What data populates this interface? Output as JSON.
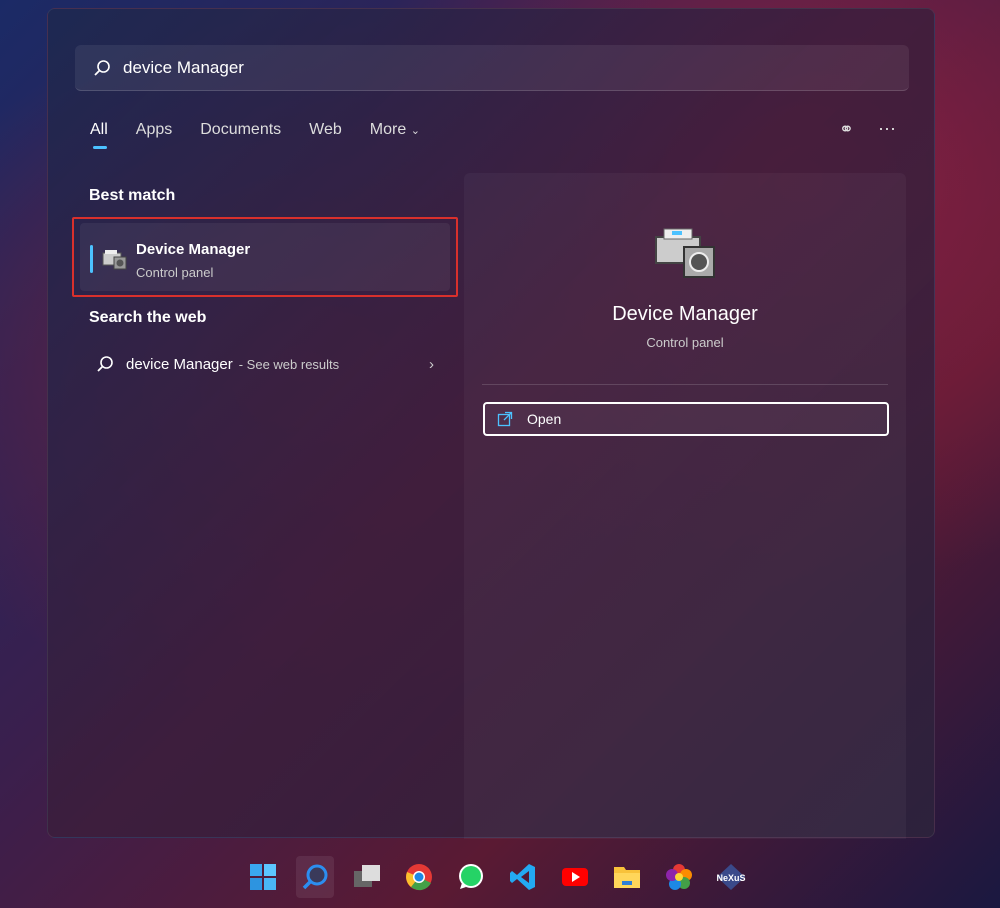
{
  "search": {
    "value": "device Manager",
    "icon": "search-icon"
  },
  "tabs": [
    {
      "label": "All",
      "active": true
    },
    {
      "label": "Apps"
    },
    {
      "label": "Documents"
    },
    {
      "label": "Web"
    },
    {
      "label": "More"
    }
  ],
  "best_match": {
    "heading": "Best match",
    "title": "Device Manager",
    "subtitle": "Control panel"
  },
  "search_web": {
    "heading": "Search the web",
    "query": "device Manager",
    "suffix": "- See web results"
  },
  "preview": {
    "title": "Device Manager",
    "subtitle": "Control panel",
    "open_label": "Open"
  },
  "taskbar": [
    "start",
    "search",
    "task-view",
    "chrome",
    "whatsapp",
    "vscode",
    "youtube",
    "file-explorer",
    "photos",
    "nexus"
  ],
  "colors": {
    "accent": "#4cc2ff",
    "highlight": "#d9302c"
  }
}
